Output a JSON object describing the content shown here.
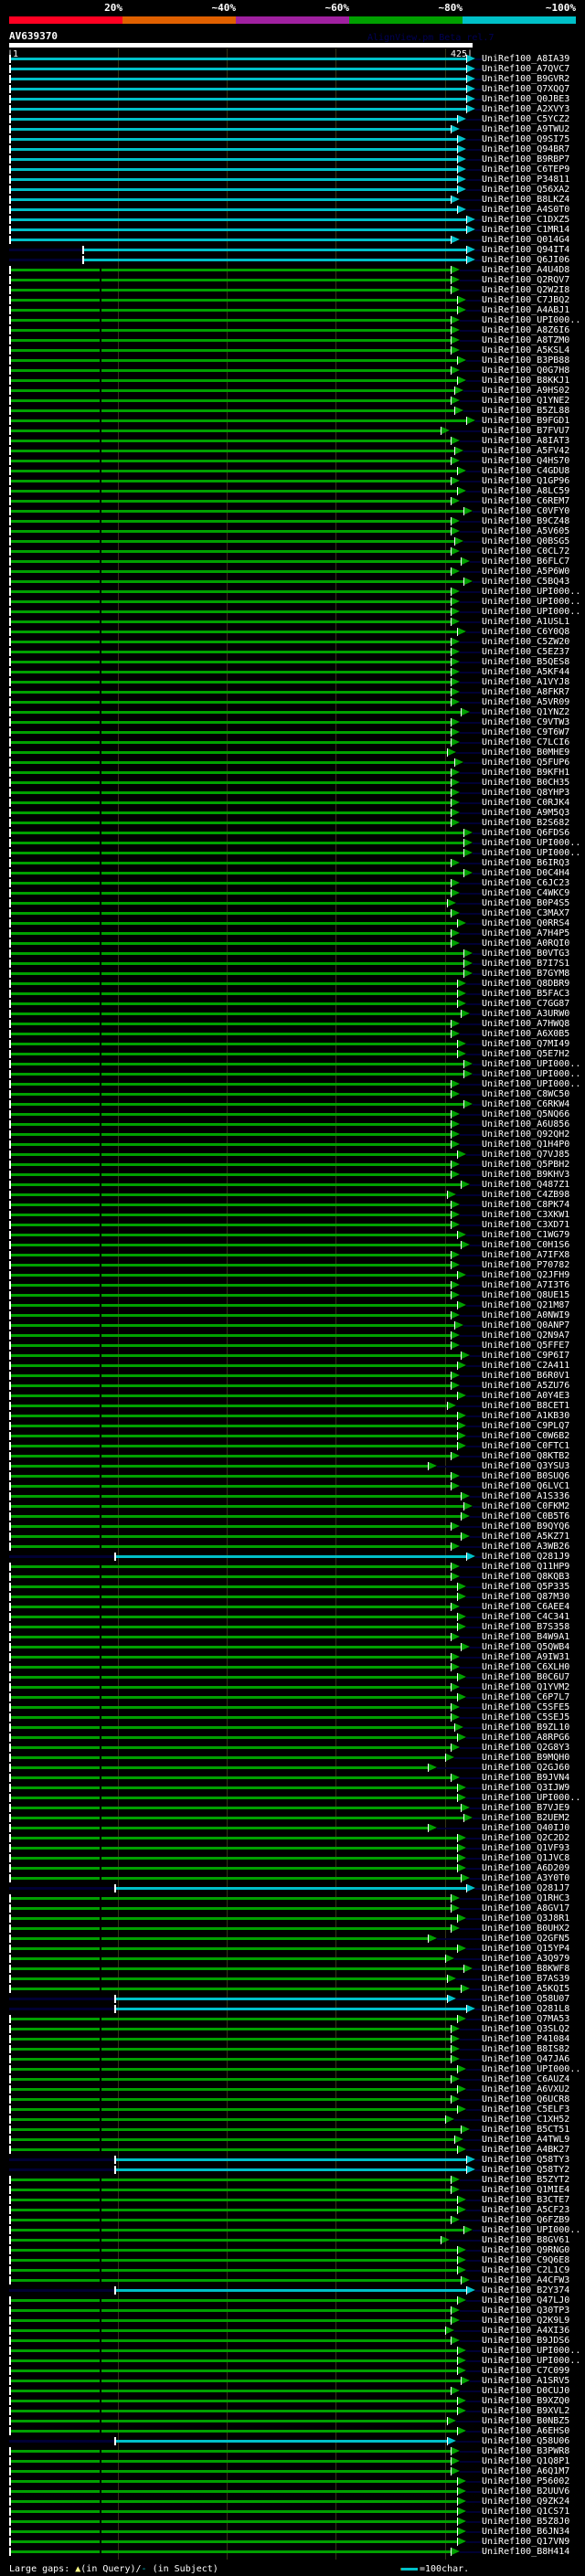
{
  "header": {
    "percent_labels": [
      "20%",
      "~40%",
      "~60%",
      "~80%",
      "~100%"
    ],
    "percent_colors": [
      "#ff0022",
      "#e06000",
      "#a020a0",
      "#00a000",
      "#00c0c8"
    ],
    "query_id": "AV639370",
    "version": "AlignView.pm Beta rel.7",
    "query_start": "|1",
    "query_end": "425|"
  },
  "query_length": 425,
  "band_colors": {
    "100": "#00c0c8",
    "80": "#00a000"
  },
  "rows": [
    [
      "UniRef100_A8IA39",
      1,
      419,
      "100"
    ],
    [
      "UniRef100_A7QVC7",
      1,
      419,
      "100"
    ],
    [
      "UniRef100_B9GVR2",
      1,
      419,
      "100"
    ],
    [
      "UniRef100_Q7XQQ7",
      1,
      419,
      "100"
    ],
    [
      "UniRef100_Q0JBE3",
      1,
      419,
      "100"
    ],
    [
      "UniRef100_A2XVY3",
      1,
      419,
      "100"
    ],
    [
      "UniRef100_C5YCZ2",
      1,
      411,
      "100"
    ],
    [
      "UniRef100_A9TWU2",
      1,
      405,
      "100"
    ],
    [
      "UniRef100_Q9SI75",
      1,
      411,
      "100"
    ],
    [
      "UniRef100_Q94BR7",
      1,
      411,
      "100"
    ],
    [
      "UniRef100_B9RBP7",
      1,
      411,
      "100"
    ],
    [
      "UniRef100_C6TEP9",
      1,
      411,
      "100"
    ],
    [
      "UniRef100_P34811",
      1,
      411,
      "100"
    ],
    [
      "UniRef100_Q56XA2",
      1,
      411,
      "100"
    ],
    [
      "UniRef100_B8LKZ4",
      1,
      405,
      "100"
    ],
    [
      "UniRef100_A4S0T0",
      1,
      411,
      "100"
    ],
    [
      "UniRef100_C1DXZ5",
      1,
      419,
      "100"
    ],
    [
      "UniRef100_C1MR14",
      1,
      419,
      "100"
    ],
    [
      "UniRef100_Q014G4",
      1,
      405,
      "100"
    ],
    [
      "UniRef100_Q94IT4",
      68,
      419,
      "100"
    ],
    [
      "UniRef100_Q6JI06",
      68,
      419,
      "100"
    ],
    [
      "UniRef100_A4U4D8",
      1,
      405,
      "80"
    ],
    [
      "UniRef100_Q2RQV7",
      1,
      405,
      "80"
    ],
    [
      "UniRef100_Q2W2I8",
      1,
      405,
      "80"
    ],
    [
      "UniRef100_C7JBQ2",
      1,
      411,
      "80"
    ],
    [
      "UniRef100_A4ABJ1",
      1,
      411,
      "80"
    ],
    [
      "UniRef100_UPI000..",
      1,
      405,
      "80"
    ],
    [
      "UniRef100_A8Z6I6",
      1,
      405,
      "80"
    ],
    [
      "UniRef100_A8TZM0",
      1,
      405,
      "80"
    ],
    [
      "UniRef100_A5KSL4",
      1,
      405,
      "80"
    ],
    [
      "UniRef100_B3PB88",
      1,
      411,
      "80"
    ],
    [
      "UniRef100_Q0G7H8",
      1,
      405,
      "80"
    ],
    [
      "UniRef100_B8KKJ1",
      1,
      411,
      "80"
    ],
    [
      "UniRef100_A9HS02",
      1,
      408,
      "80"
    ],
    [
      "UniRef100_Q1YNE2",
      1,
      405,
      "80"
    ],
    [
      "UniRef100_B5ZL88",
      1,
      408,
      "80"
    ],
    [
      "UniRef100_B9FGD1",
      1,
      419,
      "80"
    ],
    [
      "UniRef100_B7FVU7",
      1,
      396,
      "80"
    ],
    [
      "UniRef100_A8IAT3",
      1,
      405,
      "80"
    ],
    [
      "UniRef100_A5FV42",
      1,
      408,
      "80"
    ],
    [
      "UniRef100_Q4HS70",
      1,
      405,
      "80"
    ],
    [
      "UniRef100_C4GDU8",
      1,
      411,
      "80"
    ],
    [
      "UniRef100_Q1GP96",
      1,
      405,
      "80"
    ],
    [
      "UniRef100_A8LC59",
      1,
      411,
      "80"
    ],
    [
      "UniRef100_C6REM7",
      1,
      405,
      "80"
    ],
    [
      "UniRef100_C0VFY0",
      1,
      417,
      "80"
    ],
    [
      "UniRef100_B9CZ48",
      1,
      405,
      "80"
    ],
    [
      "UniRef100_A5V605",
      1,
      405,
      "80"
    ],
    [
      "UniRef100_Q0BSG5",
      1,
      408,
      "80"
    ],
    [
      "UniRef100_C0CL72",
      1,
      405,
      "80"
    ],
    [
      "UniRef100_B6FLC7",
      1,
      414,
      "80"
    ],
    [
      "UniRef100_A5P6W0",
      1,
      405,
      "80"
    ],
    [
      "UniRef100_C5BQ43",
      1,
      417,
      "80"
    ],
    [
      "UniRef100_UPI000..",
      1,
      405,
      "80"
    ],
    [
      "UniRef100_UPI000..",
      1,
      405,
      "80"
    ],
    [
      "UniRef100_UPI000..",
      1,
      405,
      "80"
    ],
    [
      "UniRef100_A1USL1",
      1,
      405,
      "80"
    ],
    [
      "UniRef100_C6Y0Q8",
      1,
      411,
      "80"
    ],
    [
      "UniRef100_C5ZW20",
      1,
      405,
      "80"
    ],
    [
      "UniRef100_C5EZ37",
      1,
      405,
      "80"
    ],
    [
      "UniRef100_B5QES8",
      1,
      405,
      "80"
    ],
    [
      "UniRef100_A5KF44",
      1,
      405,
      "80"
    ],
    [
      "UniRef100_A1VYJ8",
      1,
      405,
      "80"
    ],
    [
      "UniRef100_A8FKR7",
      1,
      405,
      "80"
    ],
    [
      "UniRef100_A5VR09",
      1,
      405,
      "80"
    ],
    [
      "UniRef100_Q1YNZ2",
      1,
      414,
      "80"
    ],
    [
      "UniRef100_C9VTW3",
      1,
      405,
      "80"
    ],
    [
      "UniRef100_C9T6W7",
      1,
      405,
      "80"
    ],
    [
      "UniRef100_C7LCI6",
      1,
      405,
      "80"
    ],
    [
      "UniRef100_B0MHE9",
      1,
      402,
      "80"
    ],
    [
      "UniRef100_Q5FUP6",
      1,
      408,
      "80"
    ],
    [
      "UniRef100_B9KFH1",
      1,
      405,
      "80"
    ],
    [
      "UniRef100_B0CH35",
      1,
      405,
      "80"
    ],
    [
      "UniRef100_Q8YHP3",
      1,
      405,
      "80"
    ],
    [
      "UniRef100_C0RJK4",
      1,
      405,
      "80"
    ],
    [
      "UniRef100_A9M5Q3",
      1,
      405,
      "80"
    ],
    [
      "UniRef100_B2S682",
      1,
      405,
      "80"
    ],
    [
      "UniRef100_Q6FDS6",
      1,
      417,
      "80"
    ],
    [
      "UniRef100_UPI000..",
      1,
      417,
      "80"
    ],
    [
      "UniRef100_UPI000..",
      1,
      417,
      "80"
    ],
    [
      "UniRef100_B6IRQ3",
      1,
      405,
      "80"
    ],
    [
      "UniRef100_D0C4H4",
      1,
      417,
      "80"
    ],
    [
      "UniRef100_C6JC23",
      1,
      405,
      "80"
    ],
    [
      "UniRef100_C4WKC9",
      1,
      405,
      "80"
    ],
    [
      "UniRef100_B0P4S5",
      1,
      402,
      "80"
    ],
    [
      "UniRef100_C3MAX7",
      1,
      405,
      "80"
    ],
    [
      "UniRef100_Q0RRS4",
      1,
      411,
      "80"
    ],
    [
      "UniRef100_A7H4P5",
      1,
      405,
      "80"
    ],
    [
      "UniRef100_A0RQI0",
      1,
      405,
      "80"
    ],
    [
      "UniRef100_B0VTG3",
      1,
      417,
      "80"
    ],
    [
      "UniRef100_B7I7S1",
      1,
      417,
      "80"
    ],
    [
      "UniRef100_B7GYM8",
      1,
      417,
      "80"
    ],
    [
      "UniRef100_Q8DBR9",
      1,
      411,
      "80"
    ],
    [
      "UniRef100_B5FAC3",
      1,
      411,
      "80"
    ],
    [
      "UniRef100_C7GG87",
      1,
      411,
      "80"
    ],
    [
      "UniRef100_A3URW0",
      1,
      414,
      "80"
    ],
    [
      "UniRef100_A7HWQ8",
      1,
      405,
      "80"
    ],
    [
      "UniRef100_A6X0B5",
      1,
      405,
      "80"
    ],
    [
      "UniRef100_Q7MI49",
      1,
      411,
      "80"
    ],
    [
      "UniRef100_Q5E7H2",
      1,
      411,
      "80"
    ],
    [
      "UniRef100_UPI000..",
      1,
      417,
      "80"
    ],
    [
      "UniRef100_UPI000..",
      1,
      417,
      "80"
    ],
    [
      "UniRef100_UPI000..",
      1,
      405,
      "80"
    ],
    [
      "UniRef100_C8WC50",
      1,
      405,
      "80"
    ],
    [
      "UniRef100_C6RKW4",
      1,
      417,
      "80"
    ],
    [
      "UniRef100_Q5NQ66",
      1,
      405,
      "80"
    ],
    [
      "UniRef100_A6U856",
      1,
      405,
      "80"
    ],
    [
      "UniRef100_Q92QH2",
      1,
      405,
      "80"
    ],
    [
      "UniRef100_Q1H4P0",
      1,
      405,
      "80"
    ],
    [
      "UniRef100_Q7VJ85",
      1,
      411,
      "80"
    ],
    [
      "UniRef100_Q5PBH2",
      1,
      405,
      "80"
    ],
    [
      "UniRef100_B9KHV3",
      1,
      405,
      "80"
    ],
    [
      "UniRef100_Q487Z1",
      1,
      414,
      "80"
    ],
    [
      "UniRef100_C4ZB98",
      1,
      402,
      "80"
    ],
    [
      "UniRef100_C8PK74",
      1,
      405,
      "80"
    ],
    [
      "UniRef100_C3XKW1",
      1,
      405,
      "80"
    ],
    [
      "UniRef100_C3XD71",
      1,
      405,
      "80"
    ],
    [
      "UniRef100_C1WG79",
      1,
      411,
      "80"
    ],
    [
      "UniRef100_C0H1S6",
      1,
      414,
      "80"
    ],
    [
      "UniRef100_A7IFX8",
      1,
      405,
      "80"
    ],
    [
      "UniRef100_P70782",
      1,
      405,
      "80"
    ],
    [
      "UniRef100_Q2JFH9",
      1,
      411,
      "80"
    ],
    [
      "UniRef100_A7I3T6",
      1,
      405,
      "80"
    ],
    [
      "UniRef100_Q8UE15",
      1,
      405,
      "80"
    ],
    [
      "UniRef100_Q21M87",
      1,
      411,
      "80"
    ],
    [
      "UniRef100_A0NWI9",
      1,
      405,
      "80"
    ],
    [
      "UniRef100_Q0ANP7",
      1,
      408,
      "80"
    ],
    [
      "UniRef100_Q2N9A7",
      1,
      405,
      "80"
    ],
    [
      "UniRef100_Q5FFE7",
      1,
      405,
      "80"
    ],
    [
      "UniRef100_C9P6I7",
      1,
      414,
      "80"
    ],
    [
      "UniRef100_C2A411",
      1,
      411,
      "80"
    ],
    [
      "UniRef100_B6R0V1",
      1,
      405,
      "80"
    ],
    [
      "UniRef100_A5ZU76",
      1,
      405,
      "80"
    ],
    [
      "UniRef100_A0Y4E3",
      1,
      411,
      "80"
    ],
    [
      "UniRef100_B8CET1",
      1,
      402,
      "80"
    ],
    [
      "UniRef100_A1KB30",
      1,
      411,
      "80"
    ],
    [
      "UniRef100_C9PLQ7",
      1,
      411,
      "80"
    ],
    [
      "UniRef100_C0W6B2",
      1,
      411,
      "80"
    ],
    [
      "UniRef100_C0FTC1",
      1,
      411,
      "80"
    ],
    [
      "UniRef100_Q8KTB2",
      1,
      405,
      "80"
    ],
    [
      "UniRef100_Q3YSU3",
      1,
      384,
      "80"
    ],
    [
      "UniRef100_B0SUQ6",
      1,
      405,
      "80"
    ],
    [
      "UniRef100_Q6LVC1",
      1,
      405,
      "80"
    ],
    [
      "UniRef100_A1S336",
      1,
      414,
      "80"
    ],
    [
      "UniRef100_C0FKM2",
      1,
      417,
      "80"
    ],
    [
      "UniRef100_C0B5T6",
      1,
      414,
      "80"
    ],
    [
      "UniRef100_B9QYQ6",
      1,
      405,
      "80"
    ],
    [
      "UniRef100_A5KZ71",
      1,
      414,
      "80"
    ],
    [
      "UniRef100_A3WB26",
      1,
      405,
      "80"
    ],
    [
      "UniRef100_Q281J9",
      97,
      419,
      "100"
    ],
    [
      "UniRef100_Q11HP9",
      1,
      405,
      "80"
    ],
    [
      "UniRef100_Q8KQB3",
      1,
      405,
      "80"
    ],
    [
      "UniRef100_Q5P335",
      1,
      411,
      "80"
    ],
    [
      "UniRef100_Q87M30",
      1,
      411,
      "80"
    ],
    [
      "UniRef100_C6AEE4",
      1,
      405,
      "80"
    ],
    [
      "UniRef100_C4C341",
      1,
      411,
      "80"
    ],
    [
      "UniRef100_B7S358",
      1,
      411,
      "80"
    ],
    [
      "UniRef100_B4W9A1",
      1,
      405,
      "80"
    ],
    [
      "UniRef100_Q5QWB4",
      1,
      414,
      "80"
    ],
    [
      "UniRef100_A9IW31",
      1,
      405,
      "80"
    ],
    [
      "UniRef100_C6XLH0",
      1,
      405,
      "80"
    ],
    [
      "UniRef100_B0C6U7",
      1,
      411,
      "80"
    ],
    [
      "UniRef100_Q1YVM2",
      1,
      405,
      "80"
    ],
    [
      "UniRef100_C6P7L7",
      1,
      411,
      "80"
    ],
    [
      "UniRef100_C5SFE5",
      1,
      405,
      "80"
    ],
    [
      "UniRef100_C5SEJ5",
      1,
      405,
      "80"
    ],
    [
      "UniRef100_B9ZL10",
      1,
      408,
      "80"
    ],
    [
      "UniRef100_A8RPG6",
      1,
      411,
      "80"
    ],
    [
      "UniRef100_Q2G8Y3",
      1,
      405,
      "80"
    ],
    [
      "UniRef100_B9MQH0",
      1,
      400,
      "80"
    ],
    [
      "UniRef100_Q2GJ60",
      1,
      384,
      "80"
    ],
    [
      "UniRef100_B9JVN4",
      1,
      405,
      "80"
    ],
    [
      "UniRef100_Q3IJW9",
      1,
      411,
      "80"
    ],
    [
      "UniRef100_UPI000..",
      1,
      411,
      "80"
    ],
    [
      "UniRef100_B7VJE9",
      1,
      414,
      "80"
    ],
    [
      "UniRef100_B2UEM2",
      1,
      417,
      "80"
    ],
    [
      "UniRef100_Q40IJ0",
      1,
      384,
      "80"
    ],
    [
      "UniRef100_Q2C2D2",
      1,
      411,
      "80"
    ],
    [
      "UniRef100_Q1VF93",
      1,
      411,
      "80"
    ],
    [
      "UniRef100_Q1JVC8",
      1,
      411,
      "80"
    ],
    [
      "UniRef100_A6D209",
      1,
      411,
      "80"
    ],
    [
      "UniRef100_A3Y0T0",
      1,
      414,
      "80"
    ],
    [
      "UniRef100_Q281J7",
      97,
      419,
      "100"
    ],
    [
      "UniRef100_Q1RHC3",
      1,
      405,
      "80"
    ],
    [
      "UniRef100_A8GV17",
      1,
      405,
      "80"
    ],
    [
      "UniRef100_Q3J8R1",
      1,
      411,
      "80"
    ],
    [
      "UniRef100_B0UHX2",
      1,
      405,
      "80"
    ],
    [
      "UniRef100_Q2GFN5",
      1,
      384,
      "80"
    ],
    [
      "UniRef100_Q15YP4",
      1,
      411,
      "80"
    ],
    [
      "UniRef100_A3Q979",
      1,
      400,
      "80"
    ],
    [
      "UniRef100_B8KWF8",
      1,
      417,
      "80"
    ],
    [
      "UniRef100_B7AS39",
      1,
      402,
      "80"
    ],
    [
      "UniRef100_A5KQI5",
      1,
      414,
      "80"
    ],
    [
      "UniRef100_Q58U07",
      97,
      402,
      "100"
    ],
    [
      "UniRef100_Q281L8",
      97,
      419,
      "100"
    ],
    [
      "UniRef100_Q7MA53",
      1,
      411,
      "80"
    ],
    [
      "UniRef100_Q3SLQ2",
      1,
      405,
      "80"
    ],
    [
      "UniRef100_P41084",
      1,
      405,
      "80"
    ],
    [
      "UniRef100_B8IS82",
      1,
      405,
      "80"
    ],
    [
      "UniRef100_Q47JA6",
      1,
      405,
      "80"
    ],
    [
      "UniRef100_UPI000..",
      1,
      411,
      "80"
    ],
    [
      "UniRef100_C6AUZ4",
      1,
      405,
      "80"
    ],
    [
      "UniRef100_A6VXU2",
      1,
      411,
      "80"
    ],
    [
      "UniRef100_Q6UCR8",
      1,
      405,
      "80"
    ],
    [
      "UniRef100_C5ELF3",
      1,
      411,
      "80"
    ],
    [
      "UniRef100_C1XH52",
      1,
      400,
      "80"
    ],
    [
      "UniRef100_B5CT51",
      1,
      414,
      "80"
    ],
    [
      "UniRef100_A4TWL9",
      1,
      408,
      "80"
    ],
    [
      "UniRef100_A4BK27",
      1,
      411,
      "80"
    ],
    [
      "UniRef100_Q58TY3",
      97,
      419,
      "100"
    ],
    [
      "UniRef100_Q58TY2",
      97,
      419,
      "100"
    ],
    [
      "UniRef100_B5ZYT2",
      1,
      405,
      "80"
    ],
    [
      "UniRef100_Q1MIE4",
      1,
      405,
      "80"
    ],
    [
      "UniRef100_B3CTE7",
      1,
      411,
      "80"
    ],
    [
      "UniRef100_A5CF23",
      1,
      411,
      "80"
    ],
    [
      "UniRef100_Q6FZB9",
      1,
      405,
      "80"
    ],
    [
      "UniRef100_UPI000..",
      1,
      417,
      "80"
    ],
    [
      "UniRef100_B8GV61",
      1,
      396,
      "80"
    ],
    [
      "UniRef100_Q9RNG0",
      1,
      411,
      "80"
    ],
    [
      "UniRef100_C9Q6E8",
      1,
      411,
      "80"
    ],
    [
      "UniRef100_C2L1C9",
      1,
      411,
      "80"
    ],
    [
      "UniRef100_A4CFW3",
      1,
      414,
      "80"
    ],
    [
      "UniRef100_B2Y374",
      97,
      419,
      "100"
    ],
    [
      "UniRef100_Q47LJ0",
      1,
      411,
      "80"
    ],
    [
      "UniRef100_Q30TP3",
      1,
      405,
      "80"
    ],
    [
      "UniRef100_Q2K9L9",
      1,
      405,
      "80"
    ],
    [
      "UniRef100_A4XI36",
      1,
      400,
      "80"
    ],
    [
      "UniRef100_B9JDS6",
      1,
      405,
      "80"
    ],
    [
      "UniRef100_UPI000..",
      1,
      411,
      "80"
    ],
    [
      "UniRef100_UPI000..",
      1,
      411,
      "80"
    ],
    [
      "UniRef100_C7C099",
      1,
      411,
      "80"
    ],
    [
      "UniRef100_A1SRV5",
      1,
      414,
      "80"
    ],
    [
      "UniRef100_D0CUJ0",
      1,
      405,
      "80"
    ],
    [
      "UniRef100_B9XZQ0",
      1,
      411,
      "80"
    ],
    [
      "UniRef100_B9XVL2",
      1,
      411,
      "80"
    ],
    [
      "UniRef100_B0NBZ5",
      1,
      402,
      "80"
    ],
    [
      "UniRef100_A6EHS0",
      1,
      411,
      "80"
    ],
    [
      "UniRef100_Q58U06",
      97,
      402,
      "100"
    ],
    [
      "UniRef100_B3PWR8",
      1,
      405,
      "80"
    ],
    [
      "UniRef100_Q1Q8P1",
      1,
      405,
      "80"
    ],
    [
      "UniRef100_A6Q1M7",
      1,
      405,
      "80"
    ],
    [
      "UniRef100_P56002",
      1,
      411,
      "80"
    ],
    [
      "UniRef100_B2UUV6",
      1,
      411,
      "80"
    ],
    [
      "UniRef100_Q9ZK24",
      1,
      411,
      "80"
    ],
    [
      "UniRef100_Q1CS71",
      1,
      411,
      "80"
    ],
    [
      "UniRef100_B5Z8J0",
      1,
      411,
      "80"
    ],
    [
      "UniRef100_B6JN34",
      1,
      411,
      "80"
    ],
    [
      "UniRef100_Q17VN9",
      1,
      411,
      "80"
    ],
    [
      "UniRef100_B8H414",
      1,
      405,
      "80"
    ]
  ],
  "footer": {
    "gaps_label": "Large gaps: ",
    "query_gap_symbol": "▲",
    "query_gap_text": "(in Query)/",
    "subject_gap_symbol": "-",
    "subject_gap_text": " (in Subject)",
    "scale_label": "=100char."
  }
}
